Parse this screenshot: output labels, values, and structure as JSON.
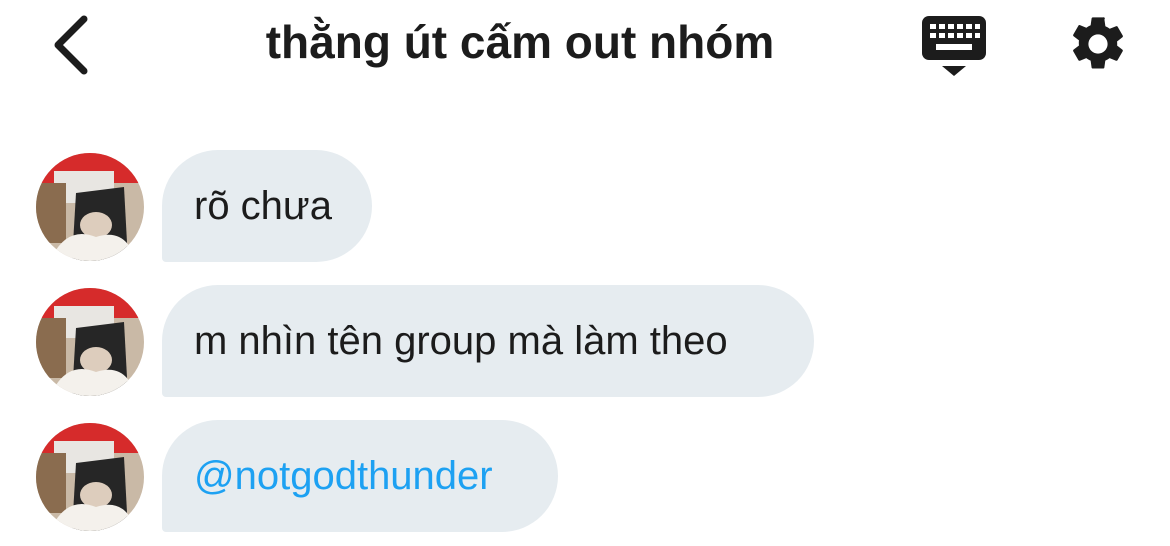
{
  "header": {
    "title": "thằng út cấm out nhóm",
    "back_icon": "chevron-left-icon",
    "keyboard_icon": "keyboard-icon",
    "settings_icon": "gear-icon"
  },
  "messages": [
    {
      "text": "rõ chưa",
      "type": "text"
    },
    {
      "text": "m nhìn tên group mà làm theo",
      "type": "text"
    },
    {
      "text": "@notgodthunder",
      "type": "mention"
    }
  ],
  "colors": {
    "bubble": "#e6ecf0",
    "mention": "#1da1f2",
    "text": "#1c1c1c"
  }
}
